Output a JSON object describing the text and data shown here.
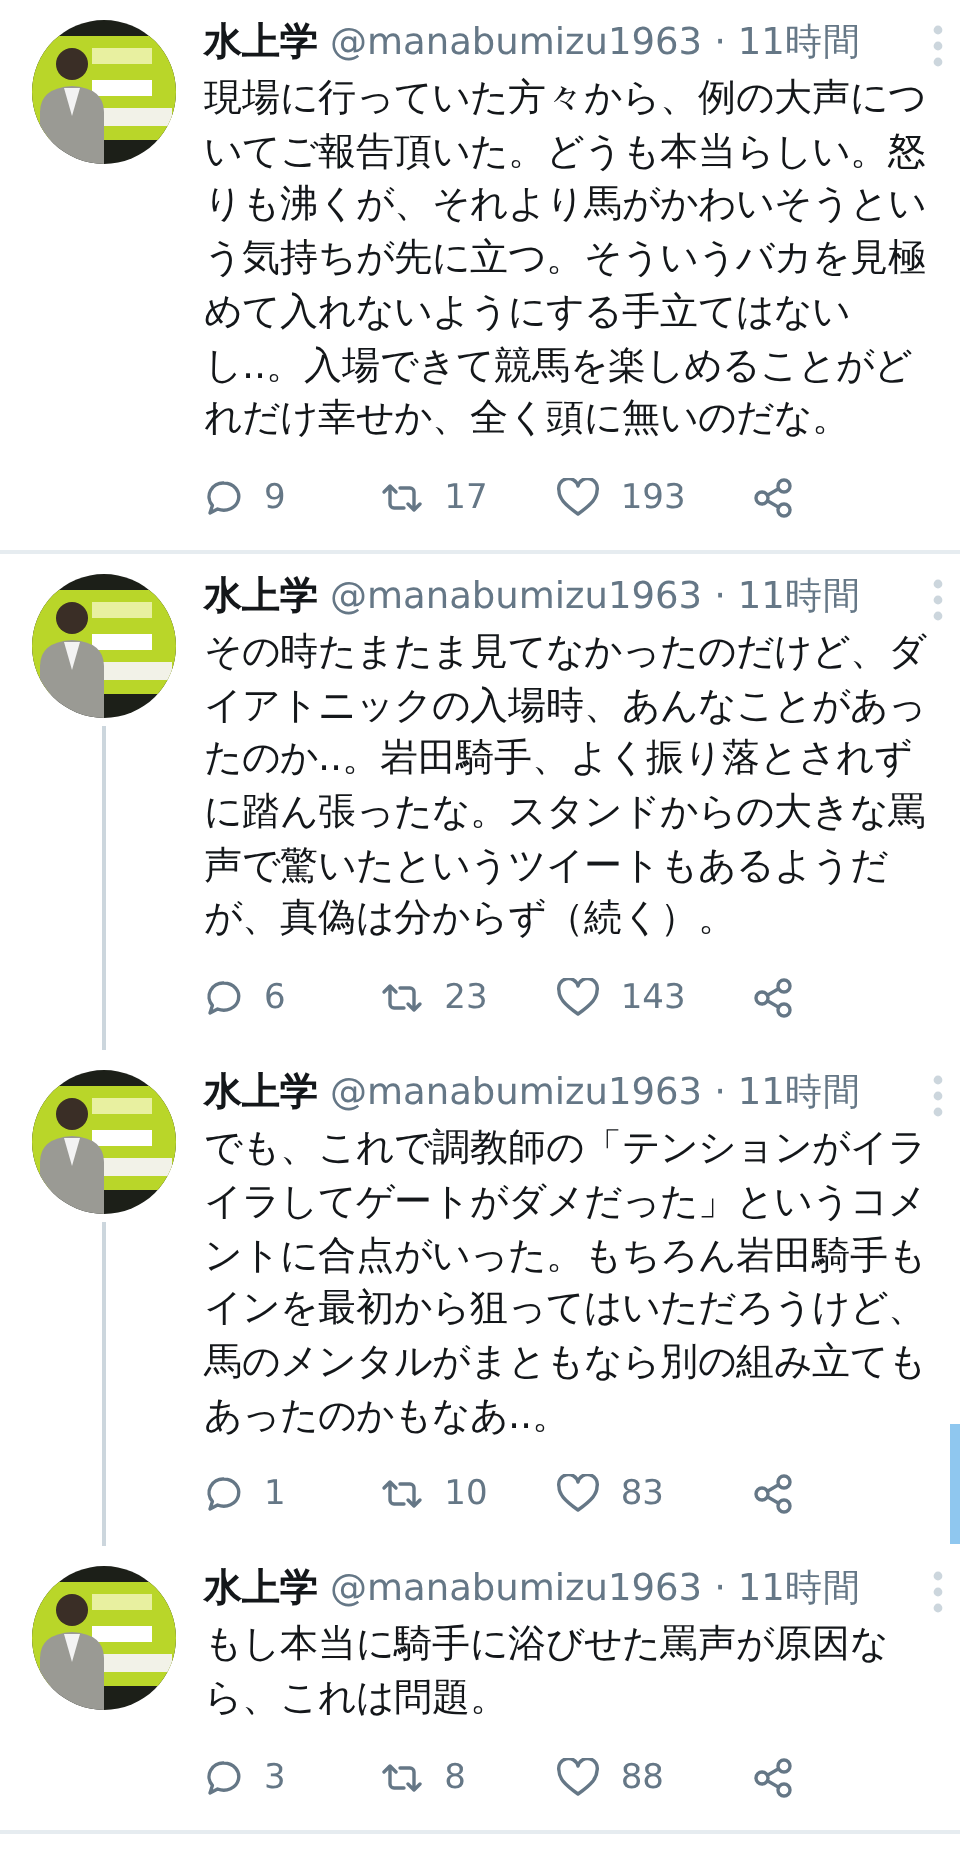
{
  "tweets": [
    {
      "name": "水上学",
      "handle": "@manabumizu1963",
      "time": "· 11時間",
      "text": "現場に行っていた方々から、例の大声についてご報告頂いた。どうも本当らしい。怒りも沸くが、それより馬がかわいそうという気持ちが先に立つ。そういうバカを見極めて入れないようにする手立てはないし..。入場できて競馬を楽しめることがどれだけ幸せか、全く頭に無いのだな。",
      "replies": "9",
      "retweets": "17",
      "likes": "193",
      "thread_below": false
    },
    {
      "name": "水上学",
      "handle": "@manabumizu1963",
      "time": "· 11時間",
      "text": "その時たまたま見てなかったのだけど、ダイアトニックの入場時、あんなことがあったのか..。岩田騎手、よく振り落とされずに踏ん張ったな。スタンドからの大きな罵声で驚いたというツイートもあるようだが、真偽は分からず（続く）。",
      "replies": "6",
      "retweets": "23",
      "likes": "143",
      "thread_below": true
    },
    {
      "name": "水上学",
      "handle": "@manabumizu1963",
      "time": "· 11時間",
      "text": "でも、これで調教師の「テンションがイライラしてゲートがダメだった」というコメントに合点がいった。もちろん岩田騎手もインを最初から狙ってはいただろうけど、馬のメンタルがまともなら別の組み立てもあったのかもなあ..。",
      "replies": "1",
      "retweets": "10",
      "likes": "83",
      "thread_below": true
    },
    {
      "name": "水上学",
      "handle": "@manabumizu1963",
      "time": "· 11時間",
      "text": "もし本当に騎手に浴びせた罵声が原因なら、これは問題。",
      "replies": "3",
      "retweets": "8",
      "likes": "88",
      "thread_below": false
    }
  ]
}
